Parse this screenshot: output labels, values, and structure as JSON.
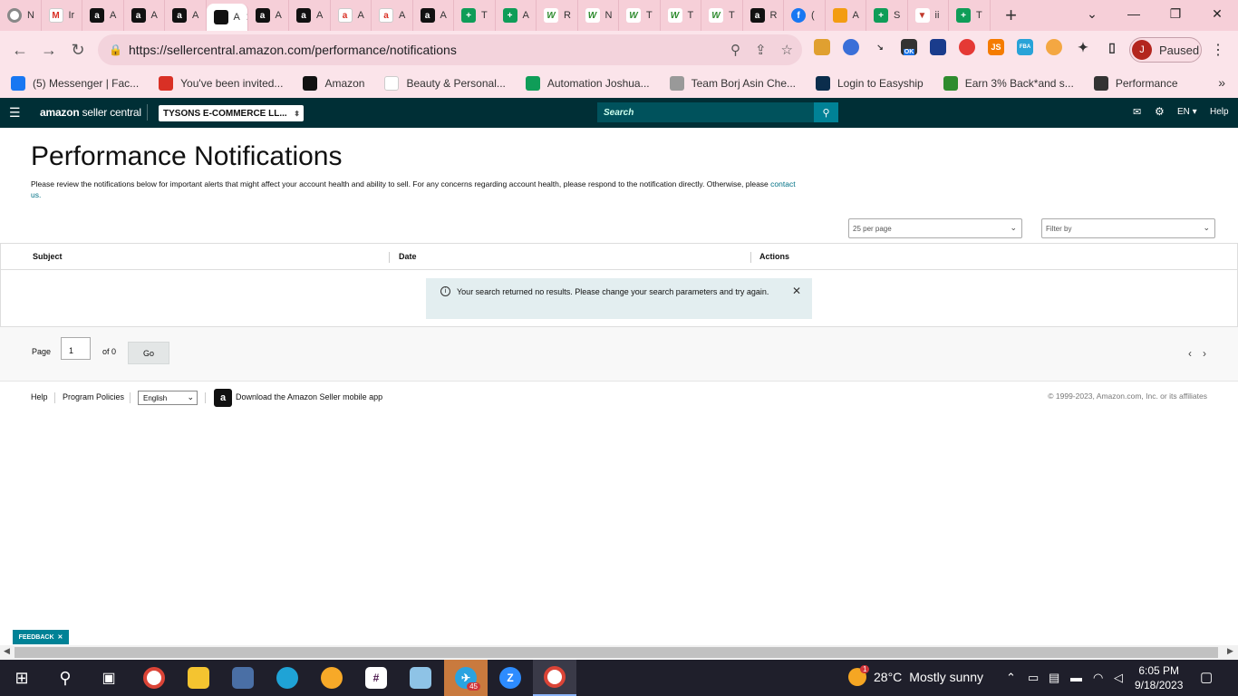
{
  "browser": {
    "tabs": [
      {
        "icon": "chrome-icon",
        "glyph": "",
        "label": "N",
        "cls": "ch"
      },
      {
        "icon": "gmail-icon",
        "glyph": "M",
        "label": "Ir",
        "cls": "gm"
      },
      {
        "icon": "amazon-icon",
        "glyph": "a",
        "label": "A",
        "cls": "amz"
      },
      {
        "icon": "amazon-icon",
        "glyph": "a",
        "label": "A",
        "cls": "amz"
      },
      {
        "icon": "amazon-icon",
        "glyph": "a",
        "label": "A",
        "cls": "amz"
      },
      {
        "icon": "amazon-icon",
        "glyph": "",
        "label": "A",
        "cls": "active"
      },
      {
        "icon": "amazon-icon",
        "glyph": "a",
        "label": "A",
        "cls": "amz"
      },
      {
        "icon": "amazon-icon",
        "glyph": "a",
        "label": "A",
        "cls": "amz"
      },
      {
        "icon": "amazon-smile-icon",
        "glyph": "a",
        "label": "A",
        "cls": "gm"
      },
      {
        "icon": "amazon-smile-icon",
        "glyph": "a",
        "label": "A",
        "cls": "gm"
      },
      {
        "icon": "amazon-icon",
        "glyph": "a",
        "label": "A",
        "cls": "amz"
      },
      {
        "icon": "sheets-icon",
        "glyph": "+",
        "label": "T",
        "cls": "sh"
      },
      {
        "icon": "sheets-icon",
        "glyph": "+",
        "label": "A",
        "cls": "sh"
      },
      {
        "icon": "w-icon",
        "glyph": "W",
        "label": "R",
        "cls": "w"
      },
      {
        "icon": "w-icon",
        "glyph": "W",
        "label": "N",
        "cls": "w"
      },
      {
        "icon": "w-icon",
        "glyph": "W",
        "label": "T",
        "cls": "w"
      },
      {
        "icon": "w-icon",
        "glyph": "W",
        "label": "T",
        "cls": "w"
      },
      {
        "icon": "w-icon",
        "glyph": "W",
        "label": "T",
        "cls": "w"
      },
      {
        "icon": "amazon-icon",
        "glyph": "a",
        "label": "R",
        "cls": "amz"
      },
      {
        "icon": "facebook-icon",
        "glyph": "f",
        "label": "(",
        "cls": "fb"
      },
      {
        "icon": "pen-icon",
        "glyph": "",
        "label": "A",
        "cls": "pen"
      },
      {
        "icon": "sheets-icon",
        "glyph": "+",
        "label": "S",
        "cls": "sh"
      },
      {
        "icon": "shield-icon",
        "glyph": "▼",
        "label": "ii",
        "cls": "red"
      },
      {
        "icon": "sheets-icon",
        "glyph": "+",
        "label": "T",
        "cls": "sh"
      }
    ],
    "active_tab_label": "A",
    "url": "https://sellercentral.amazon.com/performance/notifications",
    "profile_initial": "J",
    "profile_status": "Paused",
    "ext_js": "JS",
    "ext_fba": "FBA",
    "ext_ok": "OK"
  },
  "bookmarks": [
    {
      "icon": "facebook-icon",
      "label": "(5) Messenger | Fac..."
    },
    {
      "icon": "gmail-icon",
      "label": "You've been invited..."
    },
    {
      "icon": "amazon-icon",
      "label": "Amazon"
    },
    {
      "icon": "amazon-smile-icon",
      "label": "Beauty & Personal..."
    },
    {
      "icon": "sheets-icon",
      "label": "Automation Joshua..."
    },
    {
      "icon": "chart-icon",
      "label": "Team Borj Asin Che..."
    },
    {
      "icon": "easyship-icon",
      "label": "Login to Easyship"
    },
    {
      "icon": "w-icon",
      "label": "Earn 3% Back*and s..."
    },
    {
      "icon": "globe-icon",
      "label": "Performance"
    }
  ],
  "seller_nav": {
    "logo_brand": "amazon",
    "logo_rest": " seller central",
    "account": "TYSONS E-COMMERCE LL...",
    "search_placeholder": "Search",
    "language": "EN",
    "help": "Help"
  },
  "page": {
    "title": "Performance Notifications",
    "intro": "Please review the notifications below for important alerts that might affect your account health and ability to sell. For any concerns regarding account health, please respond to the notification directly. Otherwise, please",
    "contact_link": "contact us.",
    "per_page": "25 per page",
    "filter_by": "Filter by",
    "columns": [
      "Subject",
      "Date",
      "Actions"
    ],
    "alert_message": "Your search returned no results. Please change your search parameters and try again.",
    "pager": {
      "page_label": "Page",
      "page_value": "1",
      "of_label": "of 0",
      "go_label": "Go"
    }
  },
  "footer": {
    "help": "Help",
    "program_policies": "Program Policies",
    "language": "English",
    "download_app": "Download the Amazon Seller mobile app",
    "copyright": "© 1999-2023, Amazon.com, Inc. or its affiliates"
  },
  "feedback": "FEEDBACK",
  "taskbar": {
    "telegram_badge": "45",
    "weather_badge": "1",
    "temperature": "28°C",
    "weather": "Mostly sunny",
    "time": "6:05 PM",
    "date": "9/18/2023"
  },
  "colors": {
    "seller_nav_bg": "#002f36",
    "accent_teal": "#008296",
    "tab_strip": "#f6cfd8",
    "alert_bg": "#e3eef0"
  }
}
